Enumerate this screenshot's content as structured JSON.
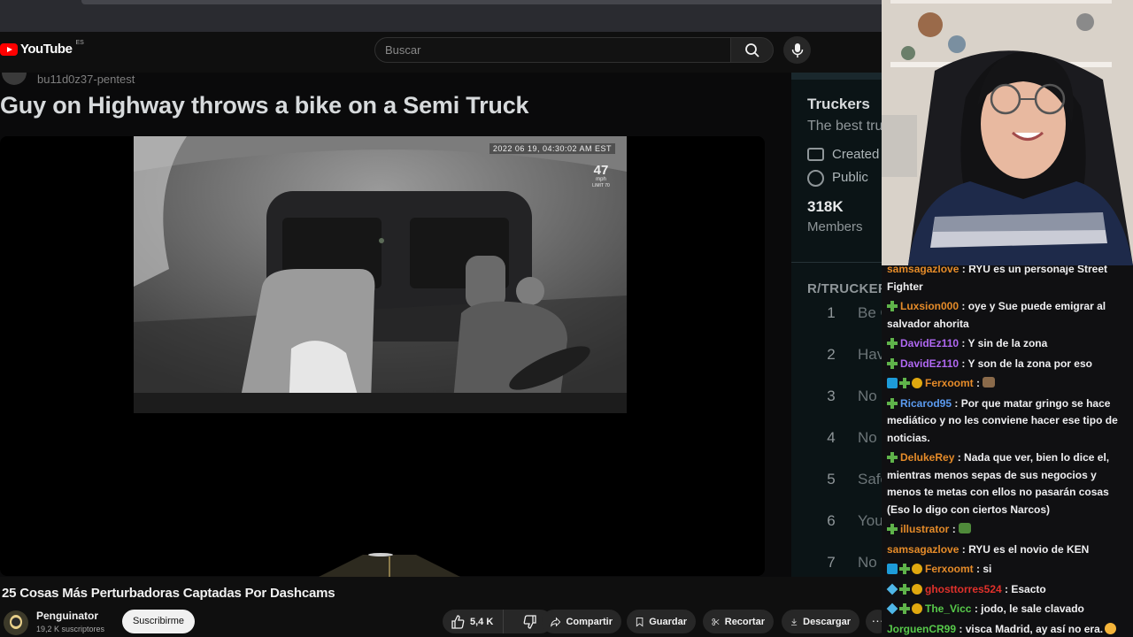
{
  "youtube": {
    "logo_text": "YouTube",
    "country_code": "ES",
    "search_placeholder": "Buscar"
  },
  "video": {
    "author": "bu11d0z37-pentest",
    "heading": "Guy on Highway throws a bike on a Semi Truck",
    "dashcam": {
      "timestamp": "2022 06 19, 04:30:02 AM EST",
      "speed": "47",
      "speed_unit": "mph",
      "speed_limit": "LIMIT 70"
    },
    "title": "25 Cosas Más Perturbadoras Captadas Por Dashcams"
  },
  "reddit_sidebar": {
    "community_name": "Truckers",
    "description": "The best tru",
    "created_label": "Created",
    "visibility_label": "Public",
    "members_count": "318K",
    "members_label": "Members",
    "rules_title": "R/TRUCKERS",
    "rules": [
      {
        "num": "1",
        "text": "Be C"
      },
      {
        "num": "2",
        "text": "Hav"
      },
      {
        "num": "3",
        "text": "No S"
      },
      {
        "num": "4",
        "text": "No B"
      },
      {
        "num": "5",
        "text": "Safe"
      },
      {
        "num": "6",
        "text": "You"
      },
      {
        "num": "7",
        "text": "No"
      }
    ]
  },
  "channel": {
    "name": "Penguinator",
    "subscribers": "19,2 K suscriptores",
    "subscribe_label": "Suscribirme"
  },
  "actions": {
    "likes": "5,4 K",
    "share": "Compartir",
    "save": "Guardar",
    "clip": "Recortar",
    "download": "Descargar",
    "more": "···"
  },
  "chat": [
    {
      "user": "samsagazlove",
      "color": "#e58b29",
      "badges": [],
      "message": ": RYU es un personaje Street Fighter"
    },
    {
      "user": "Luxsion000",
      "color": "#e58b29",
      "badges": [
        "green"
      ],
      "message": ": oye y Sue puede emigrar al salvador ahorita"
    },
    {
      "user": "DavidEz110",
      "color": "#b068f2",
      "badges": [
        "green"
      ],
      "message": ": Y sin de la zona"
    },
    {
      "user": "DavidEz110",
      "color": "#b068f2",
      "badges": [
        "green"
      ],
      "message": ": Y son de la zona por eso"
    },
    {
      "user": "Ferxoomt",
      "color": "#e58b29",
      "badges": [
        "blue",
        "green",
        "gold"
      ],
      "message": ":",
      "emote": "#8a6a4a"
    },
    {
      "user": "Ricarod95",
      "color": "#5b9bf0",
      "badges": [
        "green"
      ],
      "message": ": Por que matar gringo se hace mediático y no les conviene hacer ese tipo de noticias."
    },
    {
      "user": "DelukeRey",
      "color": "#e58b29",
      "badges": [
        "green"
      ],
      "message": ": Nada que ver, bien lo dice el, mientras menos sepas de sus negocios y menos te metas con ellos no pasarán cosas (Eso lo digo con ciertos Narcos)"
    },
    {
      "user": "illustrator",
      "color": "#e58b29",
      "badges": [
        "green"
      ],
      "message": ":",
      "emote": "#4f8a3a"
    },
    {
      "user": "samsagazlove",
      "color": "#e58b29",
      "badges": [],
      "message": ": RYU es el novio de KEN"
    },
    {
      "user": "Ferxoomt",
      "color": "#e58b29",
      "badges": [
        "blue",
        "green",
        "gold"
      ],
      "message": ": si"
    },
    {
      "user": "ghosttorres524",
      "color": "#e0312b",
      "badges": [
        "cyan",
        "green",
        "gold"
      ],
      "message": ": Esacto"
    },
    {
      "user": "The_Vicc",
      "color": "#57c94a",
      "badges": [
        "cyan",
        "green",
        "gold"
      ],
      "message": ": jodo, le sale clavado"
    },
    {
      "user": "JorguenCR99",
      "color": "#57c94a",
      "badges": [],
      "message": ": visca Madrid, ay así no era.",
      "emojis": [
        "#f4b43a",
        "#f4b43a"
      ]
    }
  ]
}
